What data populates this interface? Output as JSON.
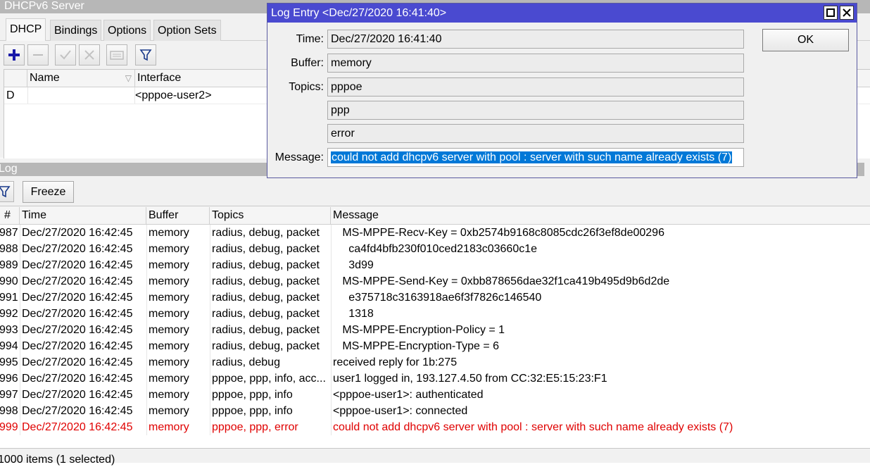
{
  "dhcp_window": {
    "title": "DHCPv6 Server",
    "tabs": [
      "DHCP",
      "Bindings",
      "Options",
      "Option Sets"
    ],
    "columns": {
      "flag": "",
      "name": "Name",
      "interface": "Interface"
    },
    "row": {
      "flag": "D",
      "name": "",
      "interface": "<pppoe-user2>"
    }
  },
  "log_window": {
    "title": "Log",
    "freeze_label": "Freeze",
    "columns": {
      "num": "#",
      "time": "Time",
      "buffer": "Buffer",
      "topics": "Topics",
      "message": "Message"
    },
    "rows": [
      {
        "num": "987",
        "time": "Dec/27/2020 16:42:45",
        "buffer": "memory",
        "topics": "radius, debug, packet",
        "message": "   MS-MPPE-Recv-Key = 0xb2574b9168c8085cdc26f3ef8de00296"
      },
      {
        "num": "988",
        "time": "Dec/27/2020 16:42:45",
        "buffer": "memory",
        "topics": "radius, debug, packet",
        "message": "     ca4fd4bfb230f010ced2183c03660c1e"
      },
      {
        "num": "989",
        "time": "Dec/27/2020 16:42:45",
        "buffer": "memory",
        "topics": "radius, debug, packet",
        "message": "     3d99"
      },
      {
        "num": "990",
        "time": "Dec/27/2020 16:42:45",
        "buffer": "memory",
        "topics": "radius, debug, packet",
        "message": "   MS-MPPE-Send-Key = 0xbb878656dae32f1ca419b495d9b6d2de"
      },
      {
        "num": "991",
        "time": "Dec/27/2020 16:42:45",
        "buffer": "memory",
        "topics": "radius, debug, packet",
        "message": "     e375718c3163918ae6f3f7826c146540"
      },
      {
        "num": "992",
        "time": "Dec/27/2020 16:42:45",
        "buffer": "memory",
        "topics": "radius, debug, packet",
        "message": "     1318"
      },
      {
        "num": "993",
        "time": "Dec/27/2020 16:42:45",
        "buffer": "memory",
        "topics": "radius, debug, packet",
        "message": "   MS-MPPE-Encryption-Policy = 1"
      },
      {
        "num": "994",
        "time": "Dec/27/2020 16:42:45",
        "buffer": "memory",
        "topics": "radius, debug, packet",
        "message": "   MS-MPPE-Encryption-Type = 6"
      },
      {
        "num": "995",
        "time": "Dec/27/2020 16:42:45",
        "buffer": "memory",
        "topics": "radius, debug",
        "message": "received reply for 1b:275"
      },
      {
        "num": "996",
        "time": "Dec/27/2020 16:42:45",
        "buffer": "memory",
        "topics": "pppoe, ppp, info, acc...",
        "message": "user1 logged in, 193.127.4.50 from CC:32:E5:15:23:F1"
      },
      {
        "num": "997",
        "time": "Dec/27/2020 16:42:45",
        "buffer": "memory",
        "topics": "pppoe, ppp, info",
        "message": "<pppoe-user1>: authenticated"
      },
      {
        "num": "998",
        "time": "Dec/27/2020 16:42:45",
        "buffer": "memory",
        "topics": "pppoe, ppp, info",
        "message": "<pppoe-user1>: connected"
      },
      {
        "num": "999",
        "time": "Dec/27/2020 16:42:45",
        "buffer": "memory",
        "topics": "pppoe, ppp, error",
        "message": "could not add dhcpv6 server with pool : server with such name already exists (7)",
        "error": true
      }
    ],
    "status": "1000 items (1 selected)"
  },
  "dialog": {
    "title": "Log Entry <Dec/27/2020 16:41:40>",
    "ok_label": "OK",
    "time_label": "Time:",
    "time": "Dec/27/2020 16:41:40",
    "buffer_label": "Buffer:",
    "buffer": "memory",
    "topics_label": "Topics:",
    "topics": [
      "pppoe",
      "ppp",
      "error"
    ],
    "message_label": "Message:",
    "message": "could not add dhcpv6 server with pool : server with such name already exists (7)"
  },
  "colors": {
    "error": "#e00000",
    "selection": "#0078d7",
    "dialog_title": "#4a4ad0"
  },
  "icons": [
    "plus-icon",
    "minus-icon",
    "check-icon",
    "x-icon",
    "comment-icon",
    "filter-icon",
    "maximize-icon",
    "close-icon"
  ]
}
